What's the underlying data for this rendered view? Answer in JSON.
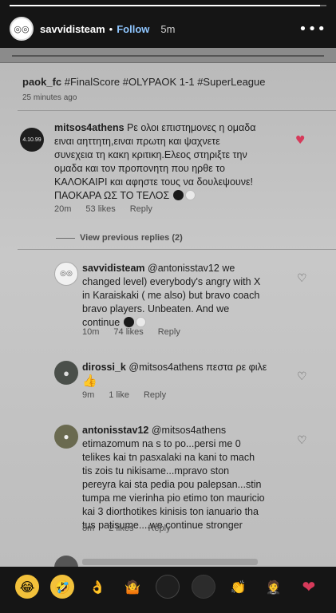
{
  "story": {
    "progress": 0.98,
    "username": "savvidisteam",
    "follow_label": "Follow",
    "time": "5m"
  },
  "caption": {
    "user": "paok_fc",
    "text": "#FinalScore #OLYPAOK 1-1 #SuperLeague",
    "time": "25 minutes ago"
  },
  "comments": [
    {
      "user": "mitsos4athens",
      "avatar_text": "4.10.99",
      "lines": [
        "Ρε ολοι επιστημονες η ομαδα",
        "ειναι αηττητη,ειναι πρωτη και ψαχνετε",
        "συνεχεια τη κακη κριτικη.Ελεος στηριξτε την",
        "ομαδα και τον προπονητη που ηρθε το",
        "ΚΑΛΟΚΑΙΡΙ και αφηστε τους να δουλεψουνε!",
        "ΠΑΟΚΑΡΑ ΩΣ ΤΟ ΤΕΛΟΣ"
      ],
      "time": "20m",
      "likes": "53 likes",
      "reply": "Reply"
    },
    {
      "user": "savvidisteam",
      "lines": [
        "@antonisstav12 we",
        "changed level) everybody's angry with X",
        "in Karaiskaki ( me also) but bravo  coach",
        "bravo players. Unbeaten. And we",
        "continue"
      ],
      "time": "10m",
      "likes": "74 likes",
      "reply": "Reply"
    },
    {
      "user": "dirossi_k",
      "lines": [
        "@mitsos4athens πεστα ρε φιλε"
      ],
      "time": "9m",
      "likes": "1 like",
      "reply": "Reply"
    },
    {
      "user": "antonisstav12",
      "lines": [
        "@mitsos4athens",
        "etimazomum na s to po...persi me 0",
        "telikes kai tn pasxalaki na kani to mach",
        "tis zois tu nikisame...mpravo ston",
        "pereyra kai sta pedia pou palepsan...stin",
        "tumpa me vierinha pio etimo ton mauricio",
        "kai 3 diorthotikes kinisis ton ianuario tha",
        "tus patisume....we continue stronger"
      ],
      "time": "8m",
      "likes": "2 likes",
      "reply": "Reply"
    }
  ],
  "view_previous": "View previous replies (2)",
  "reactions": [
    "😂",
    "🤣",
    "👌",
    "🤷",
    "⚫",
    "⚪",
    "👏",
    "🤵",
    "❤"
  ],
  "colors": {
    "accent": "#8fc6ff",
    "heart": "#d63a5a"
  }
}
